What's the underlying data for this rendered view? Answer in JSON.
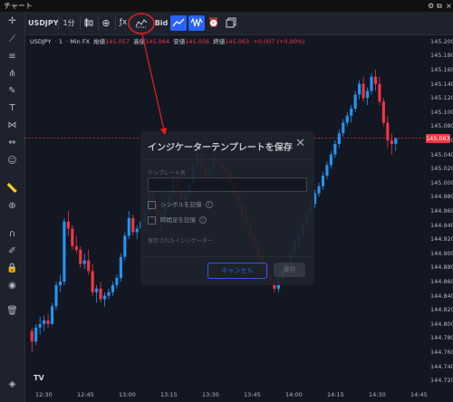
{
  "window": {
    "title": "チャート"
  },
  "toolbar": {
    "symbol": "USDJPY",
    "interval": "1分",
    "price_type": "Bid",
    "buttons": [
      "add-icon",
      "compare-icon",
      "indicators-icon",
      "candles-icon",
      "line-icon",
      "alert-icon",
      "templates-icon"
    ]
  },
  "legend": {
    "symbol": "USDJPY",
    "interval": "1",
    "source": "Min FX",
    "open_label": "始値",
    "open": "145.057",
    "high_label": "高値",
    "high": "145.064",
    "low_label": "安値",
    "low": "145.056",
    "close_label": "終値",
    "close": "145.063",
    "change": "+0.007 (+0.00%)"
  },
  "price_axis": {
    "labels": [
      "145.200",
      "145.180",
      "145.160",
      "145.140",
      "145.120",
      "145.100",
      "145.080",
      "145.060",
      "145.040",
      "145.020",
      "145.000",
      "144.980",
      "144.960",
      "144.940",
      "144.920",
      "144.900",
      "144.880",
      "144.860",
      "144.840",
      "144.820",
      "144.800",
      "144.780",
      "144.760",
      "144.740",
      "144.720"
    ],
    "current_price": "145.063"
  },
  "time_axis": {
    "labels": [
      "12:30",
      "12:45",
      "13:00",
      "13:15",
      "13:30",
      "13:45",
      "14:00",
      "14:15",
      "14:30",
      "14:45"
    ]
  },
  "colors": {
    "up": "#26a69a",
    "up_alt": "#2196f3",
    "down": "#f23645",
    "accent": "#2962ff",
    "annotation": "#e01e1e"
  },
  "dialog": {
    "title": "インジケーターテンプレートを保存",
    "name_label": "テンプレート名",
    "name_value": "",
    "checkbox_symbol": "シンボルを記憶",
    "checkbox_interval": "時間足を記憶",
    "saved_indicators_label": "保存されたインジケーター",
    "cancel_label": "キャンセル",
    "save_label": "保存"
  },
  "chart_data": {
    "type": "candlestick",
    "ylim": [
      144.71,
      145.21
    ],
    "candles": [
      [
        144.79,
        144.795,
        144.76,
        144.775
      ],
      [
        144.775,
        144.8,
        144.77,
        144.795
      ],
      [
        144.795,
        144.81,
        144.785,
        144.8
      ],
      [
        144.8,
        144.812,
        144.79,
        144.805
      ],
      [
        144.805,
        144.815,
        144.795,
        144.8
      ],
      [
        144.8,
        144.83,
        144.798,
        144.825
      ],
      [
        144.825,
        144.86,
        144.82,
        144.855
      ],
      [
        144.855,
        144.87,
        144.845,
        144.86
      ],
      [
        144.86,
        144.95,
        144.855,
        144.945
      ],
      [
        144.945,
        144.96,
        144.925,
        144.935
      ],
      [
        144.935,
        144.94,
        144.905,
        144.91
      ],
      [
        144.91,
        144.925,
        144.9,
        144.905
      ],
      [
        144.905,
        144.91,
        144.88,
        144.885
      ],
      [
        144.885,
        144.9,
        144.878,
        144.89
      ],
      [
        144.89,
        144.905,
        144.87,
        144.875
      ],
      [
        144.875,
        144.885,
        144.84,
        144.845
      ],
      [
        144.845,
        144.855,
        144.83,
        144.85
      ],
      [
        144.85,
        144.86,
        144.83,
        144.835
      ],
      [
        144.835,
        144.845,
        144.825,
        144.84
      ],
      [
        144.84,
        144.85,
        144.835,
        144.845
      ],
      [
        144.845,
        144.86,
        144.84,
        144.855
      ],
      [
        144.855,
        144.87,
        144.85,
        144.865
      ],
      [
        144.865,
        144.9,
        144.86,
        144.895
      ],
      [
        144.895,
        144.93,
        144.89,
        144.925
      ],
      [
        144.925,
        144.96,
        144.92,
        144.95
      ],
      [
        144.95,
        144.955,
        144.925,
        144.93
      ],
      [
        144.93,
        144.94,
        144.92,
        144.935
      ],
      [
        144.935,
        144.95,
        144.93,
        144.945
      ],
      [
        144.945,
        144.965,
        144.94,
        144.96
      ],
      [
        144.96,
        144.99,
        144.955,
        144.985
      ],
      [
        144.985,
        144.995,
        144.965,
        144.97
      ],
      [
        144.97,
        144.98,
        144.94,
        144.945
      ],
      [
        144.945,
        144.96,
        144.93,
        144.955
      ],
      [
        144.955,
        144.975,
        144.95,
        144.97
      ],
      [
        144.97,
        144.99,
        144.965,
        144.985
      ],
      [
        144.985,
        145.01,
        144.98,
        145.005
      ],
      [
        145.005,
        145.015,
        144.985,
        144.99
      ],
      [
        144.99,
        145.0,
        144.97,
        144.975
      ],
      [
        144.975,
        144.99,
        144.96,
        144.985
      ],
      [
        144.985,
        145.005,
        144.98,
        145.0
      ],
      [
        145.0,
        145.03,
        144.995,
        145.025
      ],
      [
        145.025,
        145.045,
        145.02,
        145.04
      ],
      [
        145.04,
        145.05,
        145.015,
        145.02
      ],
      [
        145.02,
        145.03,
        145.0,
        145.01
      ],
      [
        145.01,
        145.025,
        145.005,
        145.02
      ],
      [
        145.02,
        145.04,
        145.015,
        145.035
      ],
      [
        145.035,
        145.045,
        145.025,
        145.03
      ],
      [
        145.03,
        145.04,
        145.015,
        145.02
      ],
      [
        145.02,
        145.03,
        145.005,
        145.015
      ],
      [
        145.015,
        145.025,
        144.995,
        145.0
      ],
      [
        145.0,
        145.01,
        144.98,
        144.985
      ],
      [
        144.985,
        144.995,
        144.965,
        144.97
      ],
      [
        144.97,
        144.98,
        144.95,
        144.955
      ],
      [
        144.955,
        144.965,
        144.935,
        144.94
      ],
      [
        144.94,
        144.95,
        144.92,
        144.925
      ],
      [
        144.925,
        144.935,
        144.905,
        144.91
      ],
      [
        144.91,
        144.92,
        144.89,
        144.895
      ],
      [
        144.895,
        144.905,
        144.875,
        144.88
      ],
      [
        144.88,
        144.89,
        144.865,
        144.87
      ],
      [
        144.87,
        144.88,
        144.855,
        144.86
      ],
      [
        144.86,
        144.872,
        144.845,
        144.85
      ],
      [
        144.85,
        144.87,
        144.845,
        144.865
      ],
      [
        144.865,
        144.88,
        144.86,
        144.875
      ],
      [
        144.875,
        144.89,
        144.87,
        144.885
      ],
      [
        144.885,
        144.905,
        144.88,
        144.9
      ],
      [
        144.9,
        144.92,
        144.895,
        144.915
      ],
      [
        144.915,
        144.93,
        144.905,
        144.925
      ],
      [
        144.925,
        144.945,
        144.92,
        144.94
      ],
      [
        144.94,
        144.96,
        144.935,
        144.955
      ],
      [
        144.955,
        144.975,
        144.95,
        144.97
      ],
      [
        144.97,
        144.99,
        144.965,
        144.985
      ],
      [
        144.985,
        145.0,
        144.98,
        144.995
      ],
      [
        144.995,
        145.015,
        144.99,
        145.01
      ],
      [
        145.01,
        145.03,
        145.005,
        145.025
      ],
      [
        145.025,
        145.045,
        145.02,
        145.04
      ],
      [
        145.04,
        145.06,
        145.035,
        145.055
      ],
      [
        145.055,
        145.075,
        145.05,
        145.07
      ],
      [
        145.07,
        145.09,
        145.065,
        145.085
      ],
      [
        145.085,
        145.1,
        145.08,
        145.095
      ],
      [
        145.095,
        145.11,
        145.085,
        145.105
      ],
      [
        145.105,
        145.13,
        145.1,
        145.125
      ],
      [
        145.125,
        145.145,
        145.118,
        145.14
      ],
      [
        145.14,
        145.15,
        145.115,
        145.12
      ],
      [
        145.12,
        145.135,
        145.11,
        145.13
      ],
      [
        145.13,
        145.155,
        145.125,
        145.15
      ],
      [
        145.15,
        145.16,
        145.13,
        145.14
      ],
      [
        145.14,
        145.15,
        145.11,
        145.115
      ],
      [
        145.115,
        145.12,
        145.08,
        145.085
      ],
      [
        145.085,
        145.095,
        145.05,
        145.06
      ],
      [
        145.06,
        145.07,
        145.04,
        145.055
      ],
      [
        145.055,
        145.064,
        145.045,
        145.063
      ]
    ]
  }
}
